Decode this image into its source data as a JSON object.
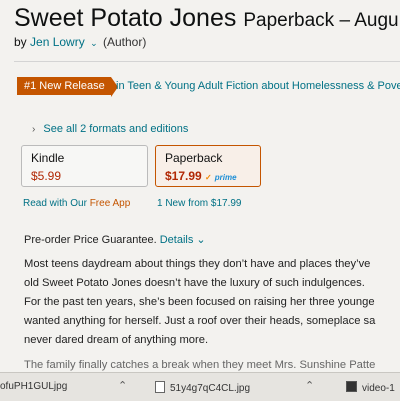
{
  "product": {
    "title": "Sweet Potato Jones",
    "format_date": "Paperback – Augu",
    "by": "by",
    "author": "Jen Lowry",
    "author_role": "(Author)"
  },
  "badge": {
    "label": "#1 New Release",
    "category": "in Teen & Young Adult Fiction about Homelessness & Pover"
  },
  "formats": {
    "see_all": "See all 2 formats and editions",
    "kindle": {
      "name": "Kindle",
      "price": "$5.99"
    },
    "paperback": {
      "name": "Paperback",
      "price": "$17.99",
      "prime": "prime"
    },
    "kindle_sub_prefix": "Read with Our",
    "kindle_sub_free": "Free App",
    "paperback_sub": "1 New from $17.99"
  },
  "guarantee": {
    "text": "Pre-order Price Guarantee.",
    "details": "Details"
  },
  "description": [
    "Most teens daydream about things they don’t have and places they’ve",
    "old Sweet Potato Jones doesn’t have the luxury of such indulgences.",
    "For the past ten years, she’s been focused on raising her three younge",
    "wanted anything for herself. Just a roof over their heads, someplace sa",
    "never dared dream of anything more.",
    "The family finally catches a break when they meet Mrs. Sunshine Patte"
  ],
  "downloads": [
    {
      "name": "ofuPH1GULjpg",
      "icon": "file-icon"
    },
    {
      "name": "51y4g7qC4CL.jpg",
      "icon": "file-icon"
    },
    {
      "name": "video-1",
      "icon": "video-icon"
    }
  ]
}
